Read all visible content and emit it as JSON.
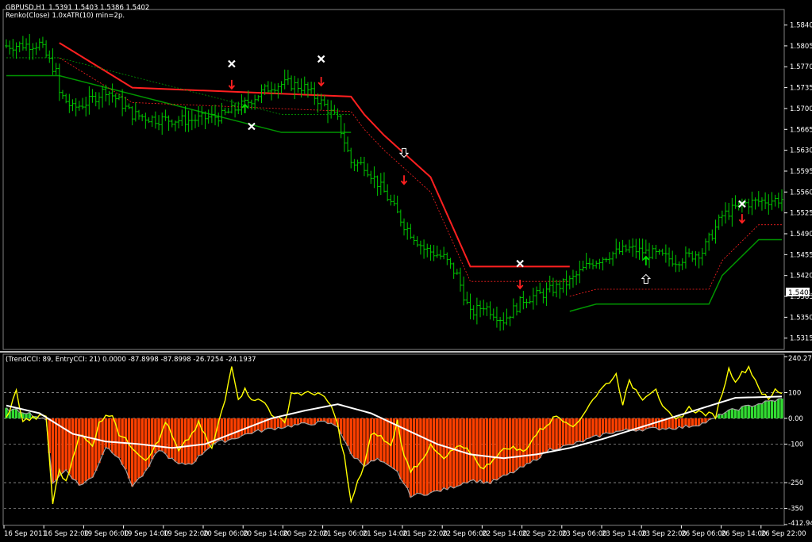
{
  "window": {
    "symbol_label": "GBPUSD,H1",
    "ohlc_label": "1.5391 1.5403 1.5386 1.5402",
    "indicator_label": "Renko(Close) 1.0xATR(10) min=2p."
  },
  "colors": {
    "background": "#000000",
    "bar": "#00c800",
    "renko_upper": "#ff2020",
    "renko_lower": "#009600",
    "cci_fill_positive": "#32dc32",
    "cci_fill_negative": "#ff4000",
    "trend_outline": "#a0a0a0",
    "entry_cci": "#ffff00",
    "ma": "#ffffff",
    "grid_text": "#ffffff"
  },
  "icons": {
    "exit_marker": "cross-icon",
    "sell_arrow": "arrow-down-icon",
    "buy_arrow": "arrow-up-icon",
    "hollow_down": "hollow-arrow-down-icon",
    "hollow_up": "hollow-arrow-up-icon"
  },
  "price_axis": {
    "ticks": [
      "1.5840",
      "1.5805",
      "1.5770",
      "1.5735",
      "1.5700",
      "1.5665",
      "1.5630",
      "1.5595",
      "1.5560",
      "1.5525",
      "1.5490",
      "1.5455",
      "1.5420",
      "1.5385",
      "1.5350",
      "1.5315"
    ],
    "current_price": "1.5402"
  },
  "cci_panel": {
    "label": "(TrendCCI: 89, EntryCCI: 21)  0.0000  -87.8998  -87.8998  -26.7254  -24.1937",
    "axis_ticks": [
      "240.275",
      "100",
      "0.00",
      "-100",
      "-250",
      "-350",
      "-412.940"
    ]
  },
  "time_axis": {
    "ticks": [
      "16 Sep 2011",
      "16 Sep 22:00",
      "19 Sep 06:00",
      "19 Sep 14:00",
      "19 Sep 22:00",
      "20 Sep 06:00",
      "20 Sep 14:00",
      "20 Sep 22:00",
      "21 Sep 06:00",
      "21 Sep 14:00",
      "21 Sep 22:00",
      "22 Sep 06:00",
      "22 Sep 14:00",
      "22 Sep 22:00",
      "23 Sep 06:00",
      "23 Sep 14:00",
      "23 Sep 22:00",
      "26 Sep 06:00",
      "26 Sep 14:00",
      "26 Sep 22:00"
    ]
  },
  "chart_data": [
    {
      "type": "ohlc",
      "title": "GBPUSD,H1",
      "ylim": [
        1.53,
        1.5862
      ],
      "x_ticks": [
        "16 Sep 2011",
        "16 Sep 22:00",
        "19 Sep 06:00",
        "19 Sep 14:00",
        "19 Sep 22:00",
        "20 Sep 06:00",
        "20 Sep 14:00",
        "20 Sep 22:00",
        "21 Sep 06:00",
        "21 Sep 14:00",
        "21 Sep 22:00",
        "22 Sep 06:00",
        "22 Sep 14:00",
        "22 Sep 22:00",
        "23 Sep 06:00",
        "23 Sep 14:00",
        "23 Sep 22:00",
        "26 Sep 06:00",
        "26 Sep 14:00",
        "26 Sep 22:00"
      ],
      "close_anchors": [
        [
          0,
          1.5805
        ],
        [
          10,
          1.5808
        ],
        [
          15,
          1.576
        ],
        [
          16,
          1.5725
        ],
        [
          20,
          1.57
        ],
        [
          25,
          1.5712
        ],
        [
          30,
          1.5732
        ],
        [
          34,
          1.5712
        ],
        [
          38,
          1.569
        ],
        [
          45,
          1.5682
        ],
        [
          55,
          1.568
        ],
        [
          65,
          1.5688
        ],
        [
          72,
          1.5708
        ],
        [
          80,
          1.5738
        ],
        [
          85,
          1.5742
        ],
        [
          90,
          1.5735
        ],
        [
          96,
          1.5705
        ],
        [
          100,
          1.568
        ],
        [
          104,
          1.561
        ],
        [
          108,
          1.5605
        ],
        [
          114,
          1.556
        ],
        [
          120,
          1.5505
        ],
        [
          126,
          1.5465
        ],
        [
          132,
          1.545
        ],
        [
          136,
          1.542
        ],
        [
          140,
          1.5355
        ],
        [
          144,
          1.537
        ],
        [
          150,
          1.5345
        ],
        [
          156,
          1.538
        ],
        [
          162,
          1.539
        ],
        [
          170,
          1.541
        ],
        [
          176,
          1.544
        ],
        [
          182,
          1.5455
        ],
        [
          188,
          1.5465
        ],
        [
          196,
          1.5455
        ],
        [
          202,
          1.5445
        ],
        [
          210,
          1.546
        ],
        [
          216,
          1.552
        ],
        [
          222,
          1.554
        ],
        [
          228,
          1.5545
        ],
        [
          234,
          1.5548
        ]
      ],
      "renko_upper_steps": [
        [
          16,
          1.581
        ],
        [
          38,
          1.5735
        ],
        [
          104,
          1.572
        ],
        [
          108,
          1.569
        ],
        [
          114,
          1.5655
        ],
        [
          128,
          1.5585
        ],
        [
          140,
          1.5435
        ],
        [
          170,
          1.5435
        ]
      ],
      "renko_lower_steps": [
        [
          0,
          1.5755
        ],
        [
          16,
          1.5755
        ],
        [
          83,
          1.566
        ],
        [
          104,
          1.566
        ]
      ],
      "renko_lower_steps_2": [
        [
          170,
          1.536
        ],
        [
          178,
          1.5372
        ],
        [
          212,
          1.5372
        ],
        [
          216,
          1.542
        ],
        [
          227,
          1.548
        ],
        [
          234,
          1.548
        ]
      ],
      "markers": [
        {
          "type": "cross",
          "bar": 68,
          "price": 1.5775
        },
        {
          "type": "cross",
          "bar": 74,
          "price": 1.567
        },
        {
          "type": "cross",
          "bar": 95,
          "price": 1.5783
        },
        {
          "type": "cross",
          "bar": 155,
          "price": 1.544
        },
        {
          "type": "cross",
          "bar": 222,
          "price": 1.554
        },
        {
          "type": "down",
          "bar": 68,
          "price": 1.574
        },
        {
          "type": "down",
          "bar": 95,
          "price": 1.5745
        },
        {
          "type": "down",
          "bar": 120,
          "price": 1.558
        },
        {
          "type": "down",
          "bar": 155,
          "price": 1.5405
        },
        {
          "type": "down",
          "bar": 222,
          "price": 1.5515
        },
        {
          "type": "up",
          "bar": 72,
          "price": 1.57
        },
        {
          "type": "up",
          "bar": 193,
          "price": 1.5445
        },
        {
          "type": "hollow_down",
          "bar": 120,
          "price": 1.5625
        },
        {
          "type": "hollow_up",
          "bar": 193,
          "price": 1.5415
        }
      ]
    },
    {
      "type": "histogram+line",
      "title": "(TrendCCI: 89, EntryCCI: 21)",
      "ylim": [
        -412.94,
        240.275
      ],
      "y_ticks": [
        240.275,
        100,
        0,
        -100,
        -250,
        -350,
        -412.94
      ],
      "trend_cci_anchors": [
        [
          0,
          35
        ],
        [
          6,
          25
        ],
        [
          12,
          -10
        ],
        [
          14,
          -250
        ],
        [
          18,
          -200
        ],
        [
          22,
          -260
        ],
        [
          26,
          -230
        ],
        [
          30,
          -110
        ],
        [
          34,
          -150
        ],
        [
          38,
          -260
        ],
        [
          42,
          -210
        ],
        [
          46,
          -120
        ],
        [
          52,
          -180
        ],
        [
          56,
          -175
        ],
        [
          62,
          -100
        ],
        [
          68,
          -80
        ],
        [
          74,
          -55
        ],
        [
          80,
          -40
        ],
        [
          88,
          -25
        ],
        [
          96,
          -15
        ],
        [
          100,
          -30
        ],
        [
          104,
          -140
        ],
        [
          108,
          -180
        ],
        [
          112,
          -160
        ],
        [
          118,
          -210
        ],
        [
          122,
          -300
        ],
        [
          128,
          -290
        ],
        [
          134,
          -270
        ],
        [
          140,
          -240
        ],
        [
          146,
          -250
        ],
        [
          152,
          -215
        ],
        [
          158,
          -175
        ],
        [
          164,
          -120
        ],
        [
          170,
          -105
        ],
        [
          176,
          -80
        ],
        [
          182,
          -55
        ],
        [
          188,
          -45
        ],
        [
          196,
          -40
        ],
        [
          204,
          -35
        ],
        [
          210,
          -20
        ],
        [
          214,
          0
        ],
        [
          216,
          20
        ],
        [
          220,
          35
        ],
        [
          228,
          60
        ],
        [
          234,
          75
        ]
      ],
      "entry_cci_anchors": [
        [
          0,
          0
        ],
        [
          3,
          105
        ],
        [
          5,
          -10
        ],
        [
          8,
          0
        ],
        [
          12,
          10
        ],
        [
          14,
          -330
        ],
        [
          16,
          -200
        ],
        [
          18,
          -250
        ],
        [
          22,
          -60
        ],
        [
          26,
          -110
        ],
        [
          28,
          -10
        ],
        [
          32,
          20
        ],
        [
          34,
          -60
        ],
        [
          38,
          -110
        ],
        [
          42,
          -160
        ],
        [
          46,
          -90
        ],
        [
          48,
          -10
        ],
        [
          52,
          -130
        ],
        [
          56,
          -60
        ],
        [
          58,
          -20
        ],
        [
          62,
          -120
        ],
        [
          64,
          -20
        ],
        [
          66,
          70
        ],
        [
          68,
          210
        ],
        [
          70,
          80
        ],
        [
          72,
          110
        ],
        [
          74,
          80
        ],
        [
          78,
          60
        ],
        [
          80,
          20
        ],
        [
          84,
          -20
        ],
        [
          86,
          100
        ],
        [
          90,
          95
        ],
        [
          94,
          100
        ],
        [
          98,
          50
        ],
        [
          100,
          -30
        ],
        [
          102,
          -150
        ],
        [
          104,
          -330
        ],
        [
          106,
          -250
        ],
        [
          108,
          -180
        ],
        [
          110,
          -70
        ],
        [
          112,
          -60
        ],
        [
          116,
          -110
        ],
        [
          118,
          -10
        ],
        [
          120,
          -150
        ],
        [
          122,
          -200
        ],
        [
          124,
          -180
        ],
        [
          128,
          -110
        ],
        [
          132,
          -160
        ],
        [
          136,
          -110
        ],
        [
          140,
          -130
        ],
        [
          144,
          -200
        ],
        [
          148,
          -140
        ],
        [
          152,
          -110
        ],
        [
          156,
          -130
        ],
        [
          160,
          -60
        ],
        [
          166,
          10
        ],
        [
          172,
          -30
        ],
        [
          176,
          60
        ],
        [
          180,
          120
        ],
        [
          184,
          170
        ],
        [
          186,
          60
        ],
        [
          188,
          140
        ],
        [
          192,
          80
        ],
        [
          196,
          120
        ],
        [
          198,
          40
        ],
        [
          202,
          -10
        ],
        [
          206,
          40
        ],
        [
          210,
          20
        ],
        [
          214,
          10
        ],
        [
          218,
          190
        ],
        [
          220,
          150
        ],
        [
          224,
          200
        ],
        [
          226,
          150
        ],
        [
          228,
          100
        ],
        [
          230,
          70
        ],
        [
          232,
          110
        ],
        [
          234,
          100
        ]
      ],
      "ma_anchors": [
        [
          0,
          50
        ],
        [
          10,
          20
        ],
        [
          20,
          -60
        ],
        [
          30,
          -90
        ],
        [
          40,
          -100
        ],
        [
          50,
          -115
        ],
        [
          60,
          -100
        ],
        [
          70,
          -50
        ],
        [
          80,
          0
        ],
        [
          90,
          30
        ],
        [
          100,
          55
        ],
        [
          110,
          20
        ],
        [
          120,
          -40
        ],
        [
          130,
          -100
        ],
        [
          140,
          -140
        ],
        [
          150,
          -155
        ],
        [
          160,
          -140
        ],
        [
          170,
          -115
        ],
        [
          180,
          -80
        ],
        [
          190,
          -40
        ],
        [
          200,
          0
        ],
        [
          210,
          40
        ],
        [
          220,
          80
        ],
        [
          234,
          85
        ]
      ]
    }
  ]
}
